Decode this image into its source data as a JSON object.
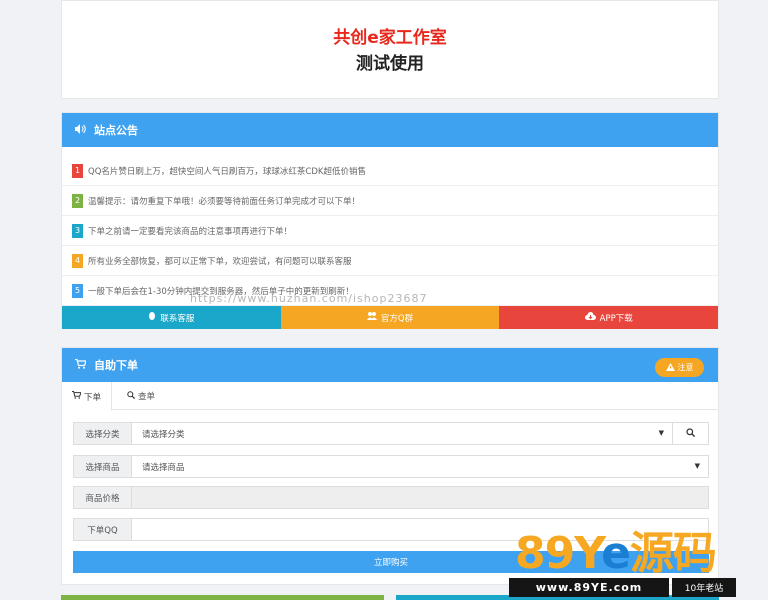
{
  "brand": {
    "title": "共创e家工作室",
    "subtitle": "测试使用"
  },
  "notice": {
    "heading": "站点公告",
    "items": [
      {
        "num": "1",
        "text": "QQ名片赞日刷上万，超快空间人气日刷百万，球球冰红茶CDK超低价销售",
        "color": "#e8453c"
      },
      {
        "num": "2",
        "text": "温馨提示：请勿重复下单哦！必须要等待前面任务订单完成才可以下单！",
        "color": "#7cb342"
      },
      {
        "num": "3",
        "text": "下单之前请一定要看完该商品的注意事项再进行下单！",
        "color": "#1ba7c9"
      },
      {
        "num": "4",
        "text": "所有业务全部恢复，都可以正常下单，欢迎尝试，有问题可以联系客服",
        "color": "#f5a623"
      },
      {
        "num": "5",
        "text": "一般下单后会在1-30分钟内提交到服务器，然后单子中的更新到刷新！",
        "color": "#3fa2f0"
      }
    ],
    "links": [
      {
        "label": "联系客服",
        "icon": "qq-icon",
        "color": "#1ba7c9"
      },
      {
        "label": "官方Q群",
        "icon": "users-icon",
        "color": "#f5a623"
      },
      {
        "label": "APP下载",
        "icon": "cloud-download-icon",
        "color": "#e8453c"
      }
    ]
  },
  "order": {
    "heading": "自助下单",
    "warn_label": "注意",
    "tabs": {
      "order": "下单",
      "query": "查单"
    },
    "category": {
      "label": "选择分类",
      "value": "请选择分类"
    },
    "product": {
      "label": "选择商品",
      "value": "请选择商品"
    },
    "price": {
      "label": "商品价格",
      "value": ""
    },
    "qq": {
      "label": "下单QQ",
      "value": ""
    },
    "buy_label": "立即购买"
  },
  "watermark": {
    "url": "https://www.huzhan.com/ishop23687",
    "logo_prefix": "89Y",
    "logo_mid": "e",
    "logo_suffix": "源码",
    "site": "www.89YE.com",
    "tag": "10年老站"
  },
  "colors": {
    "primary": "#3fa2f0",
    "accent_red": "#e8281c",
    "warn": "#f5a623"
  }
}
